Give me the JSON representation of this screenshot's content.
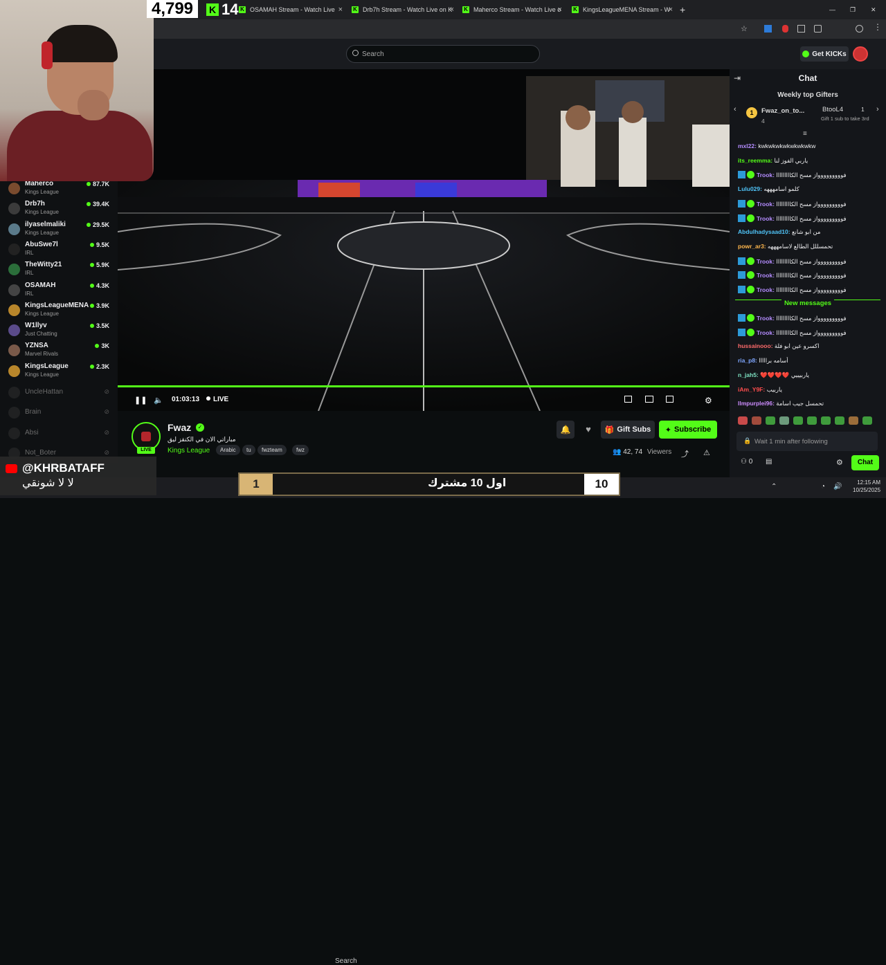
{
  "browser": {
    "tabs": [
      {
        "label": "OSAMAH Stream - Watch Live",
        "close": "×"
      },
      {
        "label": "Drb7h Stream - Watch Live on K",
        "close": "×"
      },
      {
        "label": "Maherco Stream - Watch Live o",
        "close": "×"
      },
      {
        "label": "KingsLeagueMENA Stream - W",
        "close": "×"
      }
    ],
    "new_tab": "+"
  },
  "overlay": {
    "counter_big": "4,799",
    "counter_small": "14",
    "kick_letter": "K"
  },
  "header": {
    "search_placeholder": "Search",
    "get_kicks": "Get KICKs"
  },
  "sidebar": {
    "channels": [
      {
        "name": "Maherco",
        "category": "Kings League",
        "viewers": "87.7K"
      },
      {
        "name": "Drb7h",
        "category": "Kings League",
        "viewers": "39.4K"
      },
      {
        "name": "ilyaselmaliki",
        "category": "Kings League",
        "viewers": "29.5K"
      },
      {
        "name": "AbuSwe7l",
        "category": "IRL",
        "viewers": "9.5K"
      },
      {
        "name": "TheWitty21",
        "category": "IRL",
        "viewers": "5.9K"
      },
      {
        "name": "OSAMAH",
        "category": "IRL",
        "viewers": "4.3K"
      },
      {
        "name": "KingsLeagueMENA",
        "category": "Kings League",
        "viewers": "3.9K"
      },
      {
        "name": "W1llyv",
        "category": "Just Chatting",
        "viewers": "3.5K"
      },
      {
        "name": "YZNSA",
        "category": "Marvel Rivals",
        "viewers": "3K"
      },
      {
        "name": "KingsLeague",
        "category": "Kings League",
        "viewers": "2.3K"
      }
    ],
    "offline": [
      "UncleHattan",
      "Brain",
      "Absi",
      "Not_Boter"
    ]
  },
  "player": {
    "time": "01:03:13",
    "live": "LIVE",
    "progress": 1.0
  },
  "channel": {
    "name": "Fwaz",
    "title": "مباراتي الان في الكنقز ليق",
    "category": "Kings League",
    "tags": [
      "Arabic",
      "tu",
      "fwzteam",
      "fwz"
    ],
    "live_badge": "LIVE",
    "viewers_count": "42,",
    "viewers_label": "Viewers",
    "viewers_prefix": "74",
    "gift_subs": "Gift Subs",
    "subscribe": "Subscribe"
  },
  "chat": {
    "title": "Chat",
    "gifters_title": "Weekly top Gifters",
    "gifter_1": {
      "rank": "1",
      "name": "Fwaz_on_to...",
      "count": "4"
    },
    "gifter_2": {
      "name": "BtooL4",
      "count": "1",
      "note": "Gift 1 sub to take 3rd"
    },
    "messages": [
      {
        "user": "mxl22:",
        "text": "kwkwkwkwkwkwkwkw",
        "color": "#b48cff",
        "badge": false
      },
      {
        "user": "its_reemma:",
        "text": "ياربي الفوز لنا",
        "color": "#53fc18",
        "badge": false
      },
      {
        "user": "Trook:",
        "text": "فووووووووواز مسح الكااااااااا",
        "color": "#b48cff",
        "badge": true
      },
      {
        "user": "Lulu029:",
        "text": "كلمو اسامهههه",
        "color": "#4fc3f7",
        "badge": false
      },
      {
        "user": "Trook:",
        "text": "فووووووووواز مسح الكااااااااا",
        "color": "#b48cff",
        "badge": true
      },
      {
        "user": "Trook:",
        "text": "فووووووووواز مسح الكااااااااا",
        "color": "#b48cff",
        "badge": true
      },
      {
        "user": "Abdulhadysaad10:",
        "text": "من ابو شانع",
        "color": "#4fc3f7",
        "badge": false
      },
      {
        "user": "powr_ar3:",
        "text": "تحمسللل الطالع لاسامهههه",
        "color": "#ffb74d",
        "badge": false
      },
      {
        "user": "Trook:",
        "text": "فووووووووواز مسح الكااااااااا",
        "color": "#b48cff",
        "badge": true
      },
      {
        "user": "Trook:",
        "text": "فووووووووواز مسح الكااااااااا",
        "color": "#b48cff",
        "badge": true
      },
      {
        "user": "Trook:",
        "text": "فووووووووواز مسح الكااااااااا",
        "color": "#b48cff",
        "badge": true
      }
    ],
    "new_messages_label": "New messages",
    "new_messages": [
      {
        "user": "Trook:",
        "text": "فووووووووواز مسح الكااااااااا",
        "color": "#b48cff",
        "badge": true
      },
      {
        "user": "Trook:",
        "text": "فووووووووواز مسح الكااااااااا",
        "color": "#b48cff",
        "badge": true
      },
      {
        "user": "hussainooo:",
        "text": "اكسرو عين ابو فلة",
        "color": "#ff6b6b",
        "badge": false
      },
      {
        "user": "ria_p8:",
        "text": "أسامه برااااا",
        "color": "#7fa6ff",
        "badge": false
      },
      {
        "user": "n_jah5:",
        "text": "❤️❤️❤️❤️ ياربيييي",
        "color": "#7fe3c3",
        "badge": false
      },
      {
        "user": "iAm_Y9F:",
        "text": "ياربيب",
        "color": "#ff4d4d",
        "badge": false
      },
      {
        "user": "llmpurplei96:",
        "text": "تحمسل جيب اسامة",
        "color": "#cc8cff",
        "badge": false
      }
    ],
    "input_placeholder": "Wait 1 min after following",
    "send": "Chat",
    "points": "0"
  },
  "stream_overlay": {
    "yt_user": "@KHRBATAFF",
    "yt_message": "لا لا شونقي",
    "sub_left": "1",
    "sub_text": "اول 10 مشترك",
    "sub_right": "10"
  },
  "taskbar": {
    "search": "Search",
    "time": "12:15 AM",
    "date": "10/25/2025"
  }
}
